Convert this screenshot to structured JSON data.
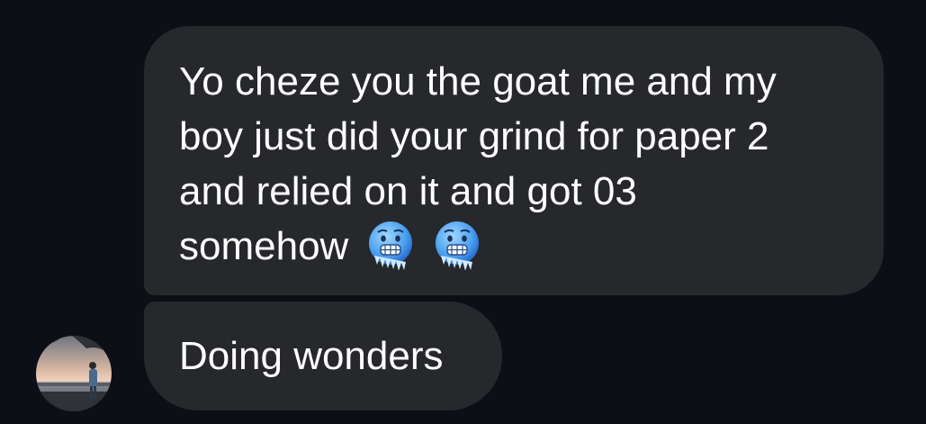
{
  "messages": [
    {
      "lines": [
        "Yo cheze you the goat me and my",
        "boy just did your grind for paper 2",
        "and relied on it and got 03",
        "somehow"
      ],
      "emoji": [
        "cold-face-emoji",
        "cold-face-emoji"
      ]
    },
    {
      "lines": [
        "Doing wonders"
      ]
    }
  ],
  "colors": {
    "background": "#0c0f15",
    "bubble": "#26282c",
    "text": "#ffffff"
  },
  "avatar": {
    "icon": "profile-photo-beach"
  }
}
